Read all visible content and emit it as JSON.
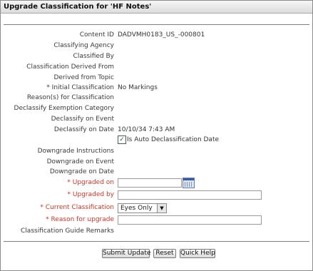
{
  "header": {
    "title": "Upgrade Classification for 'HF Notes'"
  },
  "fields": [
    {
      "label": "Content ID",
      "value": "DADVMH0183_US_-000801"
    },
    {
      "label": "Classifying Agency",
      "value": ""
    },
    {
      "label": "Classified By",
      "value": ""
    },
    {
      "label": "Classification Derived From",
      "value": ""
    },
    {
      "label": "Derived from Topic",
      "value": ""
    },
    {
      "label": "* Initial Classification",
      "value": "No Markings"
    },
    {
      "label": "Reason(s) for Classification",
      "value": ""
    },
    {
      "label": "Declassify Exemption Category",
      "value": ""
    },
    {
      "label": "Declassify on Event",
      "value": ""
    },
    {
      "label": "Declassify on Date",
      "value": "10/10/34 7:43 AM"
    },
    {
      "label": "Downgrade Instructions",
      "value": ""
    },
    {
      "label": "Downgrade on Event",
      "value": ""
    },
    {
      "label": "Downgrade on Date",
      "value": ""
    }
  ],
  "auto_declass": {
    "label": "Is Auto Declassification Date",
    "checked": true,
    "check_glyph": "✓"
  },
  "upgrade": {
    "upgraded_on_label": "* Upgraded on",
    "upgraded_on_value": "",
    "upgraded_by_label": "* Upgraded by",
    "upgraded_by_value": "",
    "current_class_label": "* Current Classification",
    "current_class_value": "Eyes Only",
    "reason_label": "* Reason for upgrade",
    "reason_value": "",
    "guide_remarks_label": "Classification Guide Remarks"
  },
  "icons": {
    "calendar": "calendar-icon",
    "dropdown": "chevron-down-icon"
  },
  "buttons": {
    "submit": "Submit Update",
    "reset": "Reset",
    "help": "Quick Help"
  },
  "colors": {
    "required_label": "#c0392b",
    "header_bg": "#dcdcdc"
  }
}
